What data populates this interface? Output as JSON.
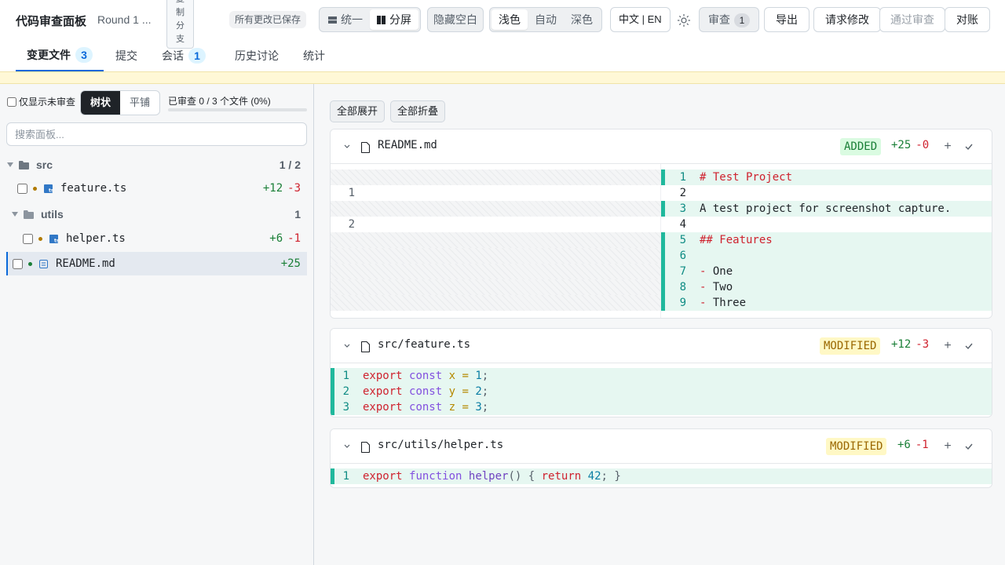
{
  "header": {
    "app_title": "代码审查面板",
    "round_label": "Round 1 ...",
    "copy_branch_label": [
      "复",
      "制",
      "分",
      "支"
    ],
    "saved_status": "所有更改已保存",
    "diff_mode": {
      "options": [
        "统一",
        "分屏"
      ],
      "selected": "分屏"
    },
    "hide_whitespace_label": "隐藏空白",
    "theme": {
      "options": [
        "浅色",
        "自动",
        "深色"
      ],
      "selected": "浅色"
    },
    "language_label": "中文 | EN",
    "review_label": "审查",
    "review_count": "1",
    "export_label": "导出",
    "request_changes_label": "请求修改",
    "approve_label": "通过审查",
    "reconcile_label": "对账"
  },
  "tabs": [
    {
      "label": "变更文件",
      "count": "3",
      "active": true
    },
    {
      "label": "提交"
    },
    {
      "label": "会话",
      "count": "1"
    },
    {
      "label": "历史讨论"
    },
    {
      "label": "统计"
    }
  ],
  "sidebar": {
    "unreviewed_only_label": "仅显示未审查",
    "view_mode": {
      "options": [
        "树状",
        "平铺"
      ],
      "selected": "树状"
    },
    "review_progress": "已审查 0 / 3 个文件 (0%)",
    "progress_fraction": 0,
    "search_placeholder": "搜索面板...",
    "tree": [
      {
        "type": "folder",
        "name": "src",
        "count": "1 / 2"
      },
      {
        "type": "file",
        "name": "feature.ts",
        "added": "+12",
        "removed": "-3"
      },
      {
        "type": "folder",
        "name": "utils",
        "count": "1"
      },
      {
        "type": "file",
        "name": "helper.ts",
        "added": "+6",
        "removed": "-1"
      },
      {
        "type": "file",
        "name": "README.md",
        "added": "+25",
        "selected": true
      }
    ]
  },
  "main": {
    "expand_all_label": "全部展开",
    "collapse_all_label": "全部折叠",
    "files": [
      {
        "path": "README.md",
        "status": "ADDED",
        "added": "+25",
        "removed": "-0",
        "left_numbers": [
          "1",
          "2"
        ],
        "right_numbers": [
          "1",
          "2",
          "3",
          "4",
          "5",
          "6",
          "7",
          "8",
          "9"
        ],
        "right_lines": [
          "# Test Project",
          "",
          "A test project for screenshot capture.",
          "",
          "## Features",
          "",
          "- One",
          "- Two",
          "- Three"
        ]
      },
      {
        "path": "src/feature.ts",
        "status": "MODIFIED",
        "added": "+12",
        "removed": "-3",
        "line_numbers": [
          "1",
          "2",
          "3"
        ],
        "lines": [
          "export const x = 1;",
          "export const y = 2;",
          "export const z = 3;"
        ]
      },
      {
        "path": "src/utils/helper.ts",
        "status": "MODIFIED",
        "added": "+6",
        "removed": "-1",
        "line_numbers": [
          "1"
        ],
        "lines": [
          "export function helper() { return 42; }"
        ]
      }
    ]
  },
  "colors": {
    "accent": "#0969da",
    "added_bar": "#1fb89c",
    "added_bg": "#e6f7f1",
    "added_text": "#1a7f37",
    "removed_text": "#cf222e",
    "modified_badge_bg": "#fff8c5",
    "banner_bg": "#fff8d6",
    "file_dot_modified": "#b07a00",
    "file_dot_added": "#1a7f37"
  },
  "icons": {
    "layout_unified": "unified-layout-icon",
    "layout_split": "split-layout-icon",
    "theme": "sun-icon",
    "folder": "folder-icon",
    "ts_file": "typescript-file-icon",
    "md_file": "markdown-file-icon",
    "document": "document-icon",
    "chevron": "chevron-down-icon",
    "check": "check-icon"
  }
}
